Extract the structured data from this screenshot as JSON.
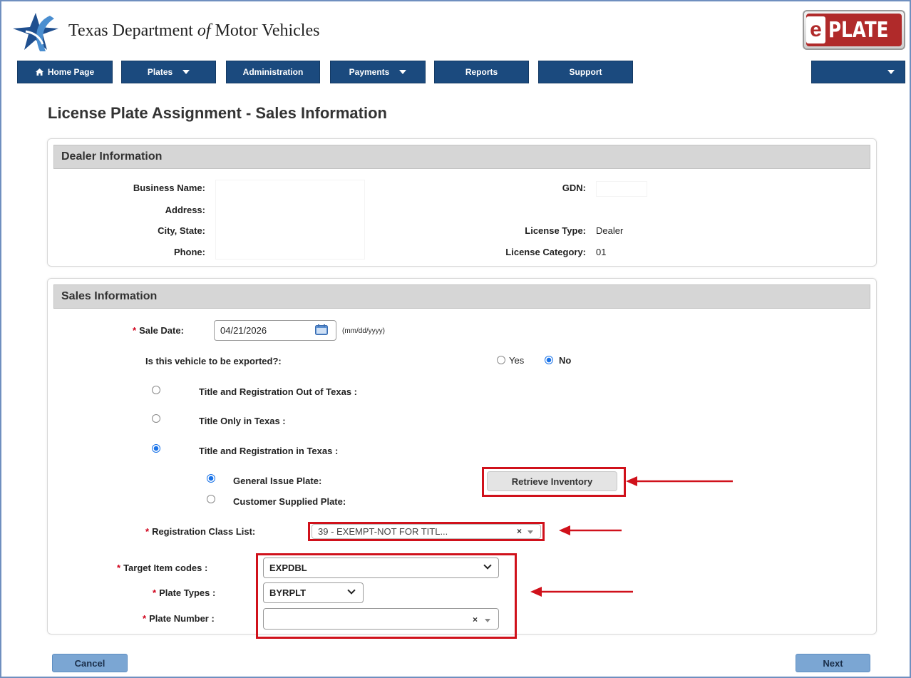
{
  "header": {
    "agency_name_part1": "Texas Department",
    "agency_name_of": "of",
    "agency_name_part2": "Motor Vehicles",
    "app_logo_e": "e",
    "app_logo_plate": "PLATE"
  },
  "nav": {
    "home": "Home Page",
    "plates": "Plates",
    "administration": "Administration",
    "payments": "Payments",
    "reports": "Reports",
    "support": "Support",
    "user_menu": ""
  },
  "page_title": "License Plate Assignment - Sales Information",
  "dealer": {
    "heading": "Dealer Information",
    "business_name_label": "Business Name:",
    "address_label": "Address:",
    "city_state_label": "City, State:",
    "phone_label": "Phone:",
    "gdn_label": "GDN:",
    "license_type_label": "License Type:",
    "license_type_value": "Dealer",
    "license_category_label": "License Category:",
    "license_category_value": "01"
  },
  "sales": {
    "heading": "Sales Information",
    "sale_date_label": "Sale Date:",
    "sale_date_value": "04/21/2026",
    "sale_date_hint": "(mm/dd/yyyy)",
    "export_question": "Is this vehicle to be exported?:",
    "export_yes": "Yes",
    "export_no": "No",
    "option_out_of_texas": "Title and Registration Out of Texas :",
    "option_title_only": "Title Only in Texas :",
    "option_title_reg_texas": "Title and Registration in Texas :",
    "general_issue_plate": "General Issue Plate:",
    "customer_supplied_plate": "Customer Supplied Plate:",
    "retrieve_inventory": "Retrieve Inventory",
    "registration_class_label": "Registration Class List:",
    "registration_class_value": "39 - EXEMPT-NOT FOR TITL...",
    "target_item_label": "Target Item codes :",
    "target_item_value": "EXPDBL",
    "plate_types_label": "Plate Types :",
    "plate_types_value": "BYRPLT",
    "plate_number_label": "Plate Number :",
    "plate_number_value": ""
  },
  "footer": {
    "cancel": "Cancel",
    "next": "Next"
  },
  "required_mark": "*",
  "clear_symbol": "×"
}
